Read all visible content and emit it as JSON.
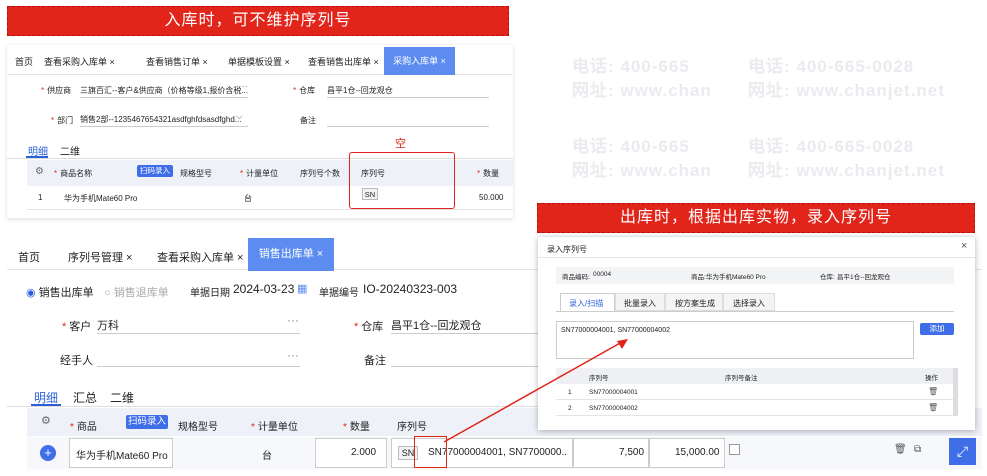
{
  "watermark": {
    "phone": "电话: 400-665-0028",
    "site": "网址: www.chanjet.net",
    "phone_partial": "电话: 400-665",
    "site_partial": "网址: www.chan"
  },
  "banner_top": "入库时，可不维护序列号",
  "banner_right": "出库时，根据出库实物，录入序列号",
  "purchase": {
    "tabs": [
      "首页",
      "查看采购入库单",
      "查看销售订单",
      "单据模板设置",
      "查看销售出库单",
      "采购入库单"
    ],
    "supplier_label": "供应商",
    "supplier_value": "三旗百汇--客户&供应商（价格等级1,报价含税...",
    "warehouse_label": "仓库",
    "warehouse_value": "昌平1仓--回龙观仓",
    "dept_label": "部门",
    "dept_value": "销售2部--1235467654321asdfghfdsasdfghd...",
    "remark_label": "备注",
    "subtabs": [
      "明细",
      "二维"
    ],
    "empty_note": "空",
    "columns": [
      "商品名称",
      "扫码录入",
      "规格型号",
      "计量单位",
      "序列号个数",
      "序列号",
      "数量"
    ],
    "row": {
      "index": "1",
      "name": "华为手机Mate60 Pro",
      "unit": "台",
      "sn_tag": "SN",
      "qty": "50.000"
    }
  },
  "sales": {
    "tabs": [
      "首页",
      "序列号管理",
      "查看采购入库单",
      "销售出库单"
    ],
    "radio_out": "销售出库单",
    "radio_return": "销售退库单",
    "date_label": "单据日期",
    "date_value": "2024-03-23",
    "code_label": "单据编号",
    "code_value": "IO-20240323-003",
    "customer_label": "客户",
    "customer_value": "万科",
    "warehouse_label": "仓库",
    "warehouse_value": "昌平1仓--回龙观仓",
    "handler_label": "经手人",
    "remark_label": "备注",
    "subtabs": [
      "明细",
      "汇总",
      "二维"
    ],
    "columns": [
      "商品",
      "扫码录入",
      "规格型号",
      "计量单位",
      "数量",
      "序列号"
    ],
    "row": {
      "name": "华为手机Mate60 Pro",
      "unit": "台",
      "qty": "2.000",
      "sn_tag": "SN",
      "serials": "SN77000004001, SN7700000...",
      "price": "7,500",
      "amount": "15,000.00"
    }
  },
  "dialog": {
    "title": "录入序列号",
    "product_code_label": "商品编码:",
    "product_code_value": "00004",
    "product_label": "商品:",
    "product_value": "华为手机Mate60 Pro",
    "warehouse_label": "仓库:",
    "warehouse_value": "昌平1仓--回龙观仓",
    "tabs": [
      "录入/扫描",
      "批量录入",
      "按方案生成",
      "选择录入"
    ],
    "input_value": "SN77000004001, SN77000004002",
    "add_button": "添加",
    "columns": [
      "序列号",
      "序列号备注",
      "操作"
    ],
    "rows": [
      {
        "index": "1",
        "serial": "SN77000004001"
      },
      {
        "index": "2",
        "serial": "SN77000004002"
      }
    ]
  }
}
